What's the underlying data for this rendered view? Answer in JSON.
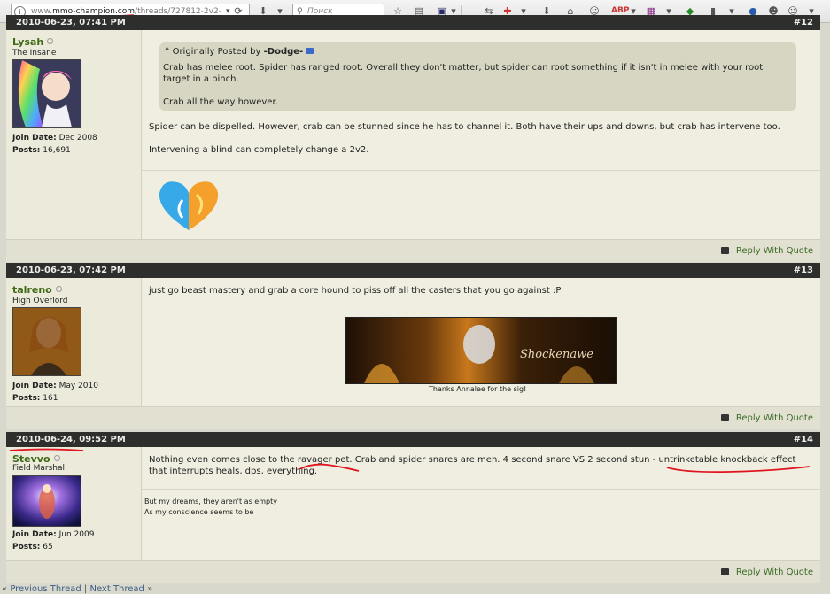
{
  "browser": {
    "url_prefix": "www.",
    "url_domain": "mmo-champion.com",
    "url_path": "/threads/727812-2v2-",
    "search_placeholder": "Поиск"
  },
  "posts": [
    {
      "date": "2010-06-23, 07:41 PM",
      "number": "#12",
      "username": "Lysah",
      "user_title": "The Insane",
      "join_date_label": "Join Date:",
      "join_date": "Dec 2008",
      "posts_label": "Posts:",
      "posts_count": "16,691",
      "quote_prefix": "Originally Posted by",
      "quote_author": "-Dodge-",
      "quote_line1": "Crab has melee root. Spider has ranged root. Overall they don't matter, but spider can root something if it isn't in melee with your root",
      "quote_line2": "target in a pinch.",
      "quote_line3": "Crab all the way however.",
      "body_line1": "Spider can be dispelled. However, crab can be stunned since he has to channel it. Both have their ups and downs, but crab has intervene too.",
      "body_line2": "Intervening a blind can completely change a 2v2.",
      "reply_label": "Reply With Quote"
    },
    {
      "date": "2010-06-23, 07:42 PM",
      "number": "#13",
      "username": "talreno",
      "user_title": "High Overlord",
      "join_date_label": "Join Date:",
      "join_date": "May 2010",
      "posts_label": "Posts:",
      "posts_count": "161",
      "body_line1": "just go beast mastery and grab a core hound to piss off all the casters that you go against :P",
      "sig_title": "Shockenawe",
      "sig_caption": "Thanks Annalee for the sig!",
      "reply_label": "Reply With Quote"
    },
    {
      "date": "2010-06-24, 09:52 PM",
      "number": "#14",
      "username": "Stevvo",
      "user_title": "Field Marshal",
      "join_date_label": "Join Date:",
      "join_date": "Jun 2009",
      "posts_label": "Posts:",
      "posts_count": "65",
      "body_line1": "Nothing even comes close to the ravager pet. Crab and spider snares are meh. 4 second snare VS 2 second stun - untrinketable knockback effect",
      "body_line2": "that interrupts heals, dps, everything.",
      "sig_line1": "But my dreams, they aren't as empty",
      "sig_line2": "As my conscience seems to be",
      "reply_label": "Reply With Quote"
    }
  ],
  "nav": {
    "prev": "Previous Thread",
    "next": "Next Thread",
    "separator": "|"
  },
  "colors": {
    "post_header": "#2e2e2c",
    "username": "#3e6a16",
    "annotation_red": "#e0141e"
  }
}
